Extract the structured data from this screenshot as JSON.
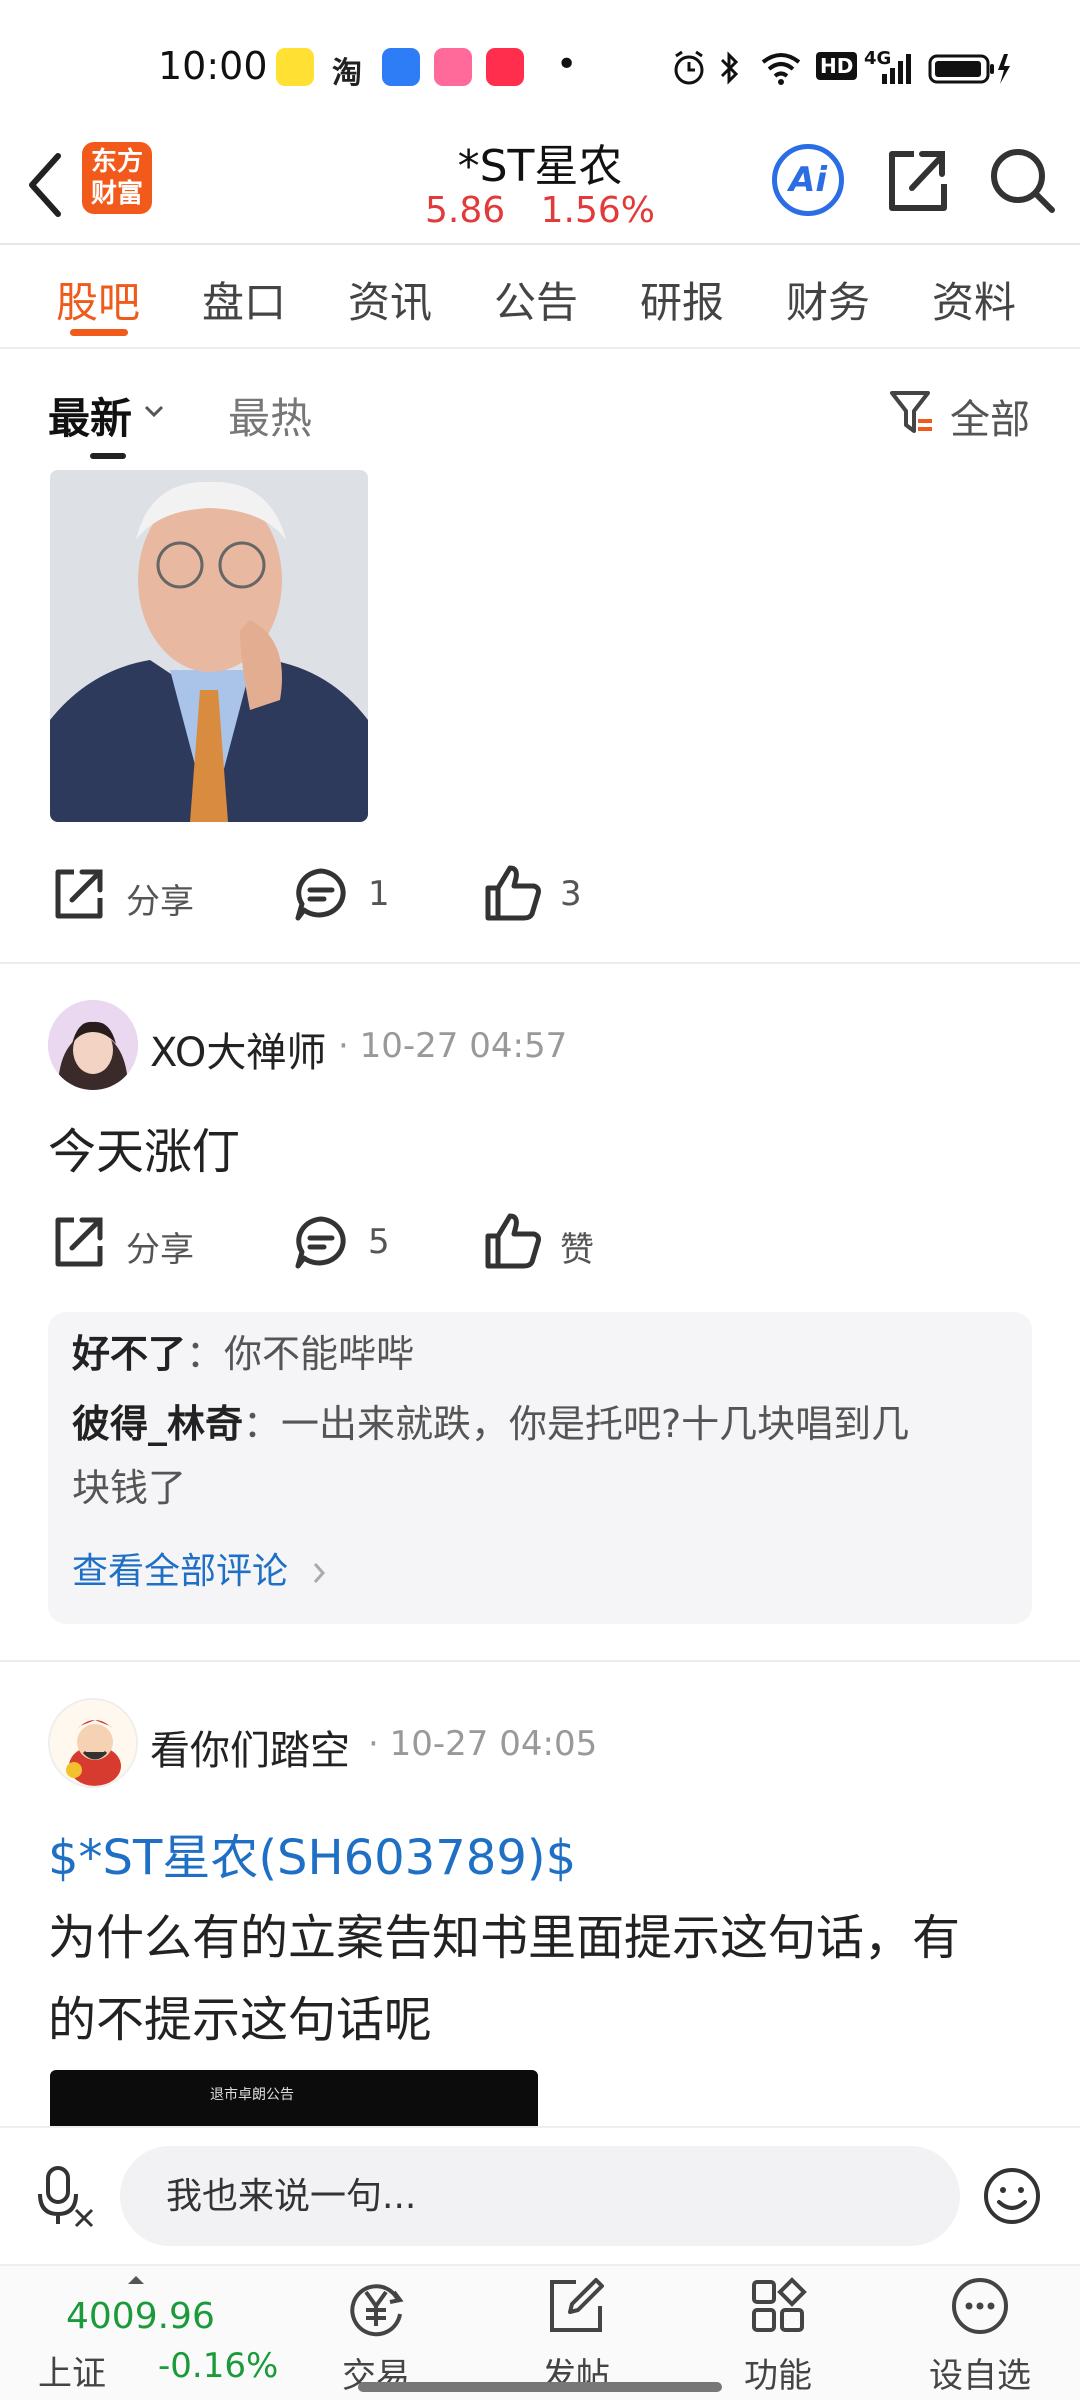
{
  "status_bar": {
    "time": "10:00",
    "apps": [
      "闲鱼",
      "淘",
      "日历",
      "bilibili",
      "小红书"
    ],
    "dot": "•",
    "network": "4G",
    "hd": "HD"
  },
  "header": {
    "logo_line1": "东方",
    "logo_line2": "财富",
    "title": "*ST星农",
    "price": "5.86",
    "change_pct": "1.56%",
    "ai_label": "Ai"
  },
  "tabs": [
    "股吧",
    "盘口",
    "资讯",
    "公告",
    "研报",
    "财务",
    "资料"
  ],
  "sort": {
    "latest": "最新",
    "hottest": "最热",
    "filter_label": "全部"
  },
  "posts": [
    {
      "share_label": "分享",
      "comment_count": "1",
      "like_count": "3"
    },
    {
      "username": "XO大禅师",
      "time": "· 10-27 04:57",
      "content": "今天涨仃",
      "share_label": "分享",
      "comment_count": "5",
      "like_label": "赞",
      "comments": [
        {
          "user": "好不了",
          "text": "：你不能哔哔"
        },
        {
          "user": "彼得_林奇",
          "text": "：一出来就跌，你是托吧?十几块唱到几",
          "text_cont": "块钱了"
        }
      ],
      "view_all": "查看全部评论"
    },
    {
      "username": "看你们踏空",
      "time": "· 10-27 04:05",
      "stock_link": "$*ST星农(SH603789)$",
      "content_line1": "为什么有的立案告知书里面提示这句话，有",
      "content_line2": "的不提示这句话呢",
      "image_caption": "退市卓朗公告"
    }
  ],
  "input": {
    "placeholder": "我也来说一句..."
  },
  "bottom_nav": {
    "index_value": "4009.96",
    "index_name": "上证",
    "index_change": "-0.16%",
    "items": [
      "交易",
      "发帖",
      "功能",
      "设自选"
    ]
  },
  "colors": {
    "accent": "#f05a1a",
    "price_up": "#e23a3a",
    "index_down": "#1a9a3a",
    "link": "#1f6fc5"
  }
}
